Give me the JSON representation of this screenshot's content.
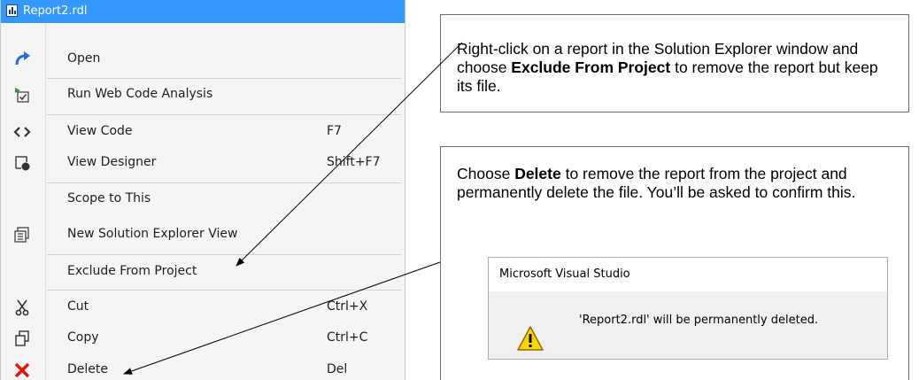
{
  "menu": {
    "title": "Report2.rdl",
    "items": [
      {
        "label": "Open",
        "shortcut": "",
        "icon": "open-arrow-icon"
      },
      {
        "label": "Run Web Code Analysis",
        "shortcut": "",
        "icon": "code-analysis-icon"
      },
      {
        "label": "View Code",
        "shortcut": "F7",
        "icon": "view-code-icon"
      },
      {
        "label": "View Designer",
        "shortcut": "Shift+F7",
        "icon": "view-designer-icon"
      },
      {
        "label": "Scope to This",
        "shortcut": "",
        "icon": ""
      },
      {
        "label": "New Solution Explorer View",
        "shortcut": "",
        "icon": "solution-explorer-icon"
      },
      {
        "label": "Exclude From Project",
        "shortcut": "",
        "icon": ""
      },
      {
        "label": "Cut",
        "shortcut": "Ctrl+X",
        "icon": "scissors-icon"
      },
      {
        "label": "Copy",
        "shortcut": "Ctrl+C",
        "icon": "copy-icon"
      },
      {
        "label": "Delete",
        "shortcut": "Del",
        "icon": "delete-x-icon"
      }
    ]
  },
  "callout1": {
    "before": "Right-click on a report in the Solution Explorer window and choose ",
    "bold": "Exclude From Project",
    "after": " to remove the report but keep its file."
  },
  "callout2": {
    "before": "Choose ",
    "bold": "Delete",
    "after": " to remove the report from the project and permanently delete the file.  You’ll be asked to confirm this."
  },
  "dialog": {
    "title": "Microsoft Visual Studio",
    "message": "'Report2.rdl' will be permanently deleted.",
    "icon": "warning-icon"
  },
  "colors": {
    "title_bar": "#3399ff",
    "open_arrow": "#1e6fd9",
    "delete_x": "#e51400",
    "warning": "#ffd700"
  }
}
